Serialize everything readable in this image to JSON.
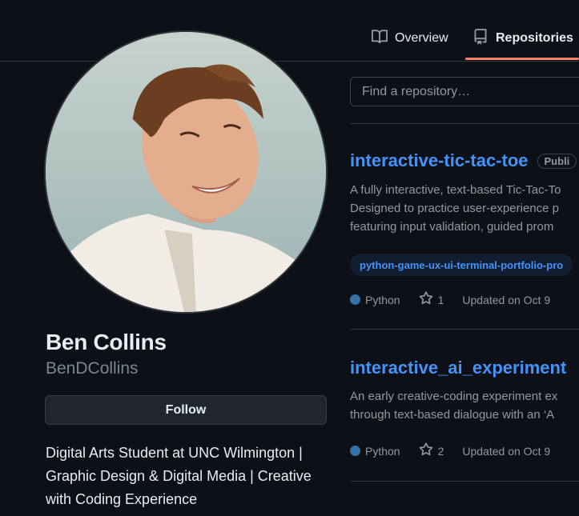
{
  "nav": {
    "tabs": [
      {
        "label": "Overview",
        "icon": "book-icon",
        "active": false
      },
      {
        "label": "Repositories",
        "icon": "repo-icon",
        "active": true
      }
    ],
    "active_underline_color": "#f78166"
  },
  "profile": {
    "name": "Ben Collins",
    "login": "BenDCollins",
    "follow_label": "Follow",
    "bio_lines": [
      "Digital Arts Student at UNC Wilmington |",
      "Graphic Design & Digital Media | Creative",
      "with Coding Experience"
    ]
  },
  "search": {
    "placeholder": "Find a repository…"
  },
  "repos": [
    {
      "name": "interactive-tic-tac-toe",
      "badge": "Publi",
      "description_lines": [
        "A fully interactive, text-based Tic-Tac-To",
        "Designed to practice user-experience p",
        "featuring input validation, guided prom"
      ],
      "topic": "python-game-ux-ui-terminal-portfolio-pro",
      "language": "Python",
      "language_color": "#3572A5",
      "stars": "1",
      "updated": "Updated on Oct 9"
    },
    {
      "name": "interactive_ai_experiment",
      "badge": "",
      "description_lines": [
        "An early creative-coding experiment ex",
        "through text-based dialogue with an ‘A"
      ],
      "topic": "",
      "language": "Python",
      "language_color": "#3572A5",
      "stars": "2",
      "updated": "Updated on Oct 9"
    }
  ],
  "colors": {
    "background": "#0d1117",
    "link": "#4493f8",
    "muted": "#9198a1",
    "border": "#30363d"
  }
}
